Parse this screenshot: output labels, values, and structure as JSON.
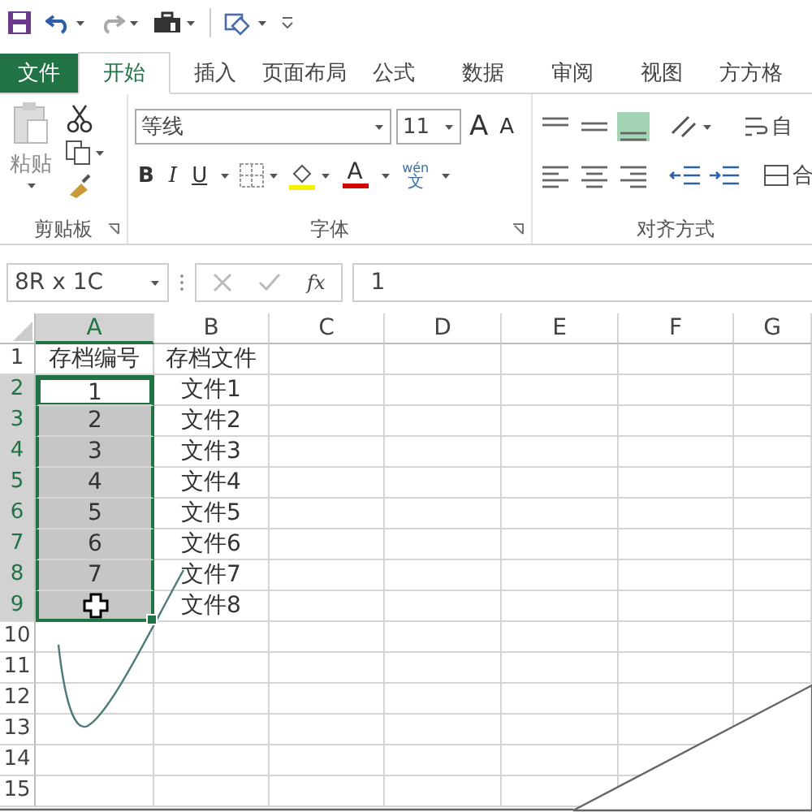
{
  "tabs": [
    {
      "label": "文件",
      "kind": "file",
      "selected": false
    },
    {
      "label": "开始",
      "kind": "tab",
      "selected": true
    },
    {
      "label": "插入",
      "kind": "tab",
      "selected": false
    },
    {
      "label": "页面布局",
      "kind": "tab",
      "selected": false
    },
    {
      "label": "公式",
      "kind": "tab",
      "selected": false
    },
    {
      "label": "数据",
      "kind": "tab",
      "selected": false
    },
    {
      "label": "审阅",
      "kind": "tab",
      "selected": false
    },
    {
      "label": "视图",
      "kind": "tab",
      "selected": false
    },
    {
      "label": "方方格",
      "kind": "tab",
      "selected": false
    }
  ],
  "ribbon": {
    "clipboard": {
      "paste_label": "粘贴",
      "group_label": "剪贴板"
    },
    "font": {
      "font_name": "等线",
      "font_size": "11",
      "grow": "A",
      "shrink": "A",
      "bold": "B",
      "italic": "I",
      "underline": "U",
      "font_color": "A",
      "phonetic_top": "wén",
      "phonetic_bottom": "文",
      "group_label": "字体"
    },
    "alignment": {
      "wrap_label": "自",
      "merge_label": "合",
      "group_label": "对齐方式"
    }
  },
  "formula_bar": {
    "name_box": "8R x 1C",
    "fx": "fx",
    "formula": "1"
  },
  "sheet": {
    "columns": [
      {
        "label": "A",
        "selected": true
      },
      {
        "label": "B",
        "selected": false
      },
      {
        "label": "C",
        "selected": false
      },
      {
        "label": "D",
        "selected": false
      },
      {
        "label": "E",
        "selected": false
      },
      {
        "label": "F",
        "selected": false
      },
      {
        "label": "G",
        "selected": false
      }
    ],
    "rows": [
      {
        "header": "1",
        "selected": false,
        "active": false,
        "cells": [
          "存档编号",
          "存档文件"
        ]
      },
      {
        "header": "2",
        "selected": true,
        "active": true,
        "cells": [
          "1",
          "文件1"
        ]
      },
      {
        "header": "3",
        "selected": true,
        "active": false,
        "cells": [
          "2",
          "文件2"
        ]
      },
      {
        "header": "4",
        "selected": true,
        "active": false,
        "cells": [
          "3",
          "文件3"
        ]
      },
      {
        "header": "5",
        "selected": true,
        "active": false,
        "cells": [
          "4",
          "文件4"
        ]
      },
      {
        "header": "6",
        "selected": true,
        "active": false,
        "cells": [
          "5",
          "文件5"
        ]
      },
      {
        "header": "7",
        "selected": true,
        "active": false,
        "cells": [
          "6",
          "文件6"
        ]
      },
      {
        "header": "8",
        "selected": true,
        "active": false,
        "cells": [
          "7",
          "文件7"
        ]
      },
      {
        "header": "9",
        "selected": true,
        "active": false,
        "cells": [
          null,
          "文件8"
        ]
      },
      {
        "header": "10",
        "selected": false,
        "active": false,
        "cells": []
      },
      {
        "header": "11",
        "selected": false,
        "active": false,
        "cells": []
      },
      {
        "header": "12",
        "selected": false,
        "active": false,
        "cells": []
      },
      {
        "header": "13",
        "selected": false,
        "active": false,
        "cells": []
      },
      {
        "header": "14",
        "selected": false,
        "active": false,
        "cells": []
      },
      {
        "header": "15",
        "selected": false,
        "active": false,
        "cells": []
      }
    ]
  }
}
